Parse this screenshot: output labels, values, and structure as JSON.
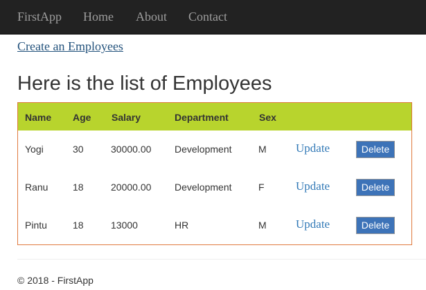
{
  "navbar": {
    "brand": "FirstApp",
    "items": [
      "Home",
      "About",
      "Contact"
    ]
  },
  "create_link": "Create an Employees",
  "page_title": "Here is the list of Employees",
  "table": {
    "headers": [
      "Name",
      "Age",
      "Salary",
      "Department",
      "Sex"
    ],
    "rows": [
      {
        "name": "Yogi",
        "age": "30",
        "salary": "30000.00",
        "department": "Development",
        "sex": "M"
      },
      {
        "name": "Ranu",
        "age": "18",
        "salary": "20000.00",
        "department": "Development",
        "sex": "F"
      },
      {
        "name": "Pintu",
        "age": "18",
        "salary": "13000",
        "department": "HR",
        "sex": "M"
      }
    ],
    "update_label": "Update",
    "delete_label": "Delete"
  },
  "footer": "© 2018 - FirstApp",
  "colors": {
    "navbar_bg": "#222222",
    "header_row_bg": "#b8d42d",
    "table_border": "#e07a3e",
    "delete_button_bg": "#3d73b8",
    "link": "#337ab7"
  }
}
